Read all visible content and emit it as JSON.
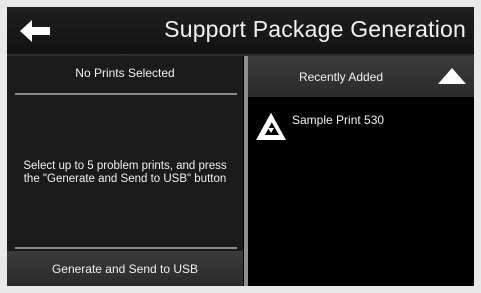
{
  "header": {
    "title": "Support Package Generation",
    "back_icon": "arrow-left-icon"
  },
  "left_panel": {
    "title": "No Prints Selected",
    "instructions_line1": "Select up to 5 problem prints, and press",
    "instructions_line2": "the \"Generate and Send to USB\" button",
    "generate_button": "Generate and Send to USB"
  },
  "right_panel": {
    "sort_label": "Recently Added",
    "sort_icon": "triangle-up-icon",
    "prints": [
      {
        "name": "Sample Print 530",
        "icon": "print-logo-icon"
      }
    ]
  },
  "colors": {
    "screen_bg": "#000000",
    "panel_bg": "#1a1a1a",
    "button_bg": "#333333",
    "text": "#f0f0f0",
    "divider": "#8f8f8f"
  }
}
